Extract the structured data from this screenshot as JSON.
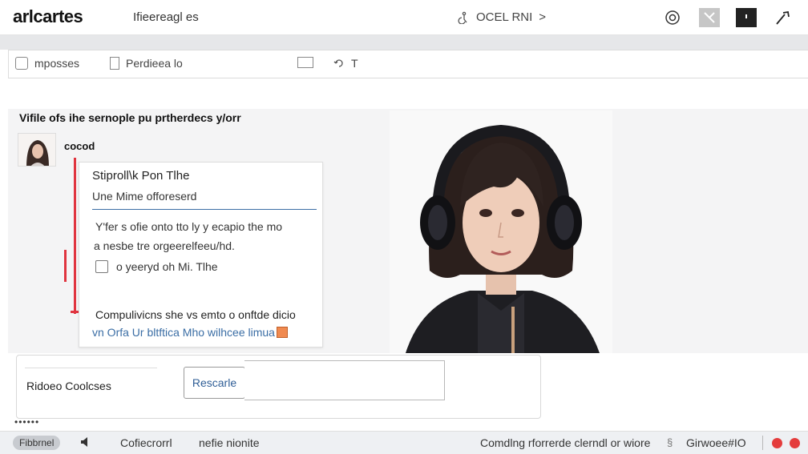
{
  "topbar": {
    "brand": "arlcartes",
    "subtitle": "Ifieereagl es",
    "center_text": "OCEL RNI",
    "center_arrow": ">",
    "icons": [
      "target-icon",
      "gray-square-icon",
      "dark-square-icon",
      "pen-icon"
    ]
  },
  "tabs": [
    {
      "label": "mposses",
      "icon": "box-icon"
    },
    {
      "label": "Perdieea lo",
      "icon": "document-icon"
    },
    {
      "label": "",
      "icon": "screen-icon"
    },
    {
      "label": "T",
      "icon": "rotate-icon"
    }
  ],
  "content": {
    "heading": "Vifile ofs ihe sernople pu prtherdecs y/orr",
    "user": {
      "name": "cocod"
    },
    "card": {
      "title": "Stiproll\\k Pon Tlhe",
      "field_value": "Une Mime offoreserd",
      "body_line1": "Y'fer s ofie onto tto ly y ecapio the mo",
      "body_line2": "a nesbe tre orgeerelfeeu/hd.",
      "checkbox_label": "o yeeryd oh Mi. Tlhe",
      "footer_line1": "Compulivicns she vs emto o onftde dicio",
      "footer_line2": "vn Orfa Ur bltftica Mho wilhcee limua"
    }
  },
  "form": {
    "label": "Ridoeo Coolcses",
    "button_label": "Rescarle"
  },
  "dots": "••••••",
  "status": {
    "pill": "Fibbrnel",
    "left_a": "Cofiecrorrl",
    "left_b": "nefie nionite",
    "right_text": "Comdlng rforrerde clerndl or wiore",
    "user_name": "Girwoee#IO"
  },
  "colors": {
    "accent_red": "#e0343f",
    "link_blue": "#3b6ea5",
    "status_red": "#e43c3c"
  }
}
